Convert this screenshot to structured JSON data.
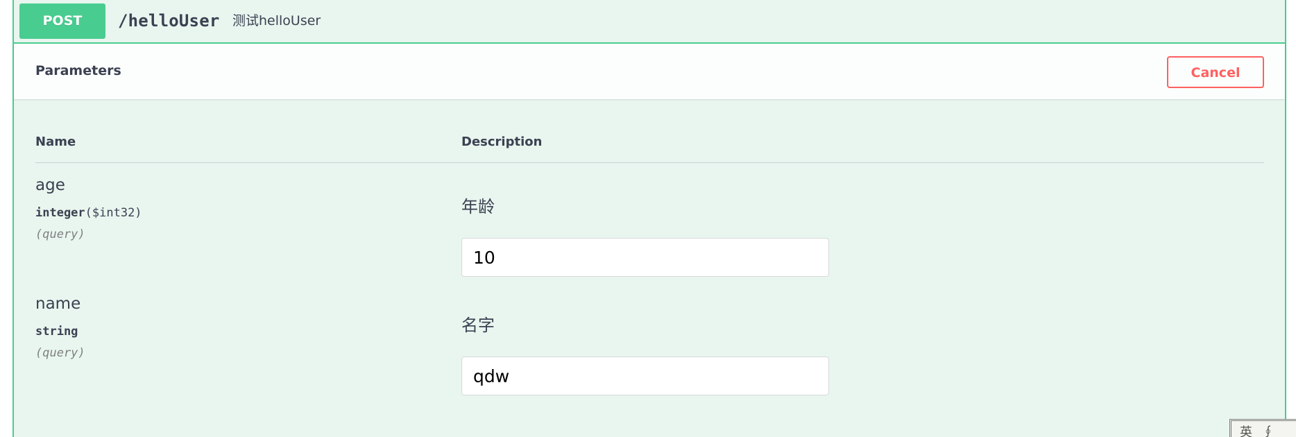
{
  "operation": {
    "method": "POST",
    "path": "/helloUser",
    "summary": "测试helloUser",
    "method_color": "#49cc90"
  },
  "parameters_section": {
    "title": "Parameters",
    "cancel_label": "Cancel",
    "cancel_color": "#ff6060"
  },
  "table": {
    "col_name": "Name",
    "col_description": "Description"
  },
  "params": [
    {
      "name": "age",
      "type": "integer",
      "format": "($int32)",
      "in": "(query)",
      "description": "年龄",
      "value": "10"
    },
    {
      "name": "name",
      "type": "string",
      "format": "",
      "in": "(query)",
      "description": "名字",
      "value": "qdw"
    }
  ],
  "corner_text": "英 ∮ 拼"
}
